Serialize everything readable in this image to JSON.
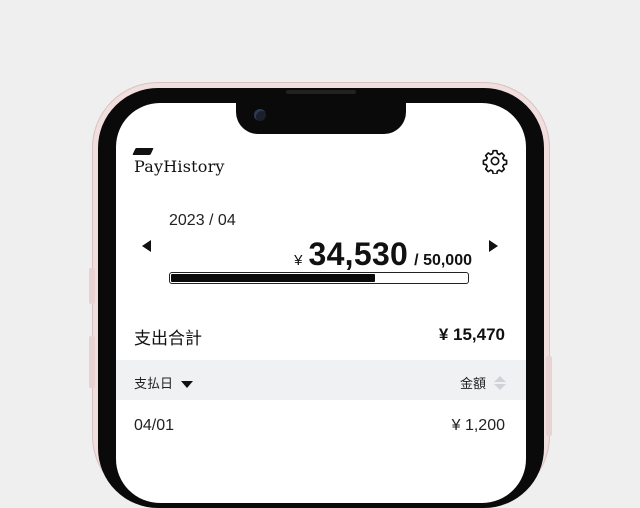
{
  "app": {
    "logo_text": "PayHistory"
  },
  "summary": {
    "month": "2023 / 04",
    "currency_symbol": "¥",
    "spent": "34,530",
    "budget": "/ 50,000",
    "progress": 0.69
  },
  "totals": {
    "label": "支出合計",
    "value": "¥ 15,470"
  },
  "table": {
    "columns": [
      {
        "label": "支払日",
        "sort": "descending"
      },
      {
        "label": "金額",
        "sort": "none"
      }
    ],
    "rows": [
      {
        "date": "04/01",
        "amount": "¥ 1,200"
      }
    ]
  },
  "icons": {
    "settings": "gear-icon",
    "prev": "triangle-left-icon",
    "next": "triangle-right-icon"
  },
  "colors": {
    "accent": "#0a0a0a",
    "header_bg": "#f0f1f3",
    "phone_frame": "#f1dede"
  }
}
